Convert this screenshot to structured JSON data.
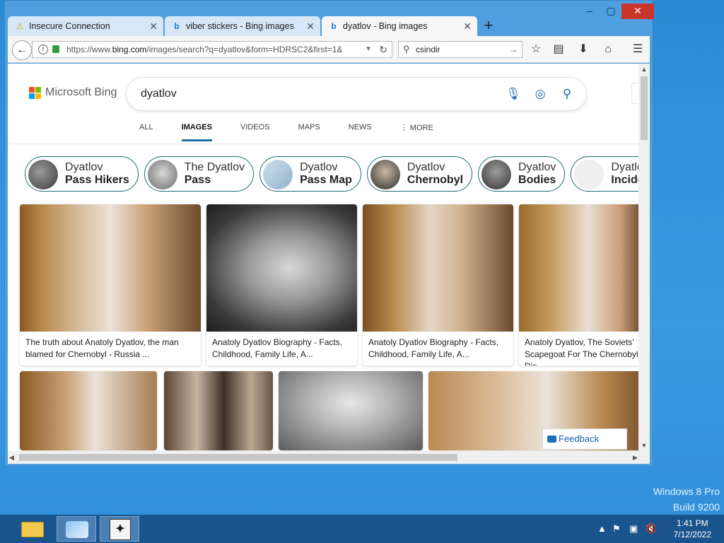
{
  "window": {
    "controls": {
      "minimize": "–",
      "maximize": "▢",
      "close": "✕"
    },
    "tabs": [
      {
        "label": "Insecure Connection",
        "icon": "warning-icon",
        "active": false
      },
      {
        "label": "viber stickers - Bing images",
        "icon": "bing-icon",
        "active": false
      },
      {
        "label": "dyatlov - Bing images",
        "icon": "bing-icon",
        "active": true
      }
    ],
    "new_tab": "+",
    "url": {
      "prefix": "https://www.",
      "host": "bing.com",
      "path": "/images/search?q=dyatlov&form=HDRSC2&first=1&"
    },
    "search_value": "csindir"
  },
  "bing": {
    "logo_text": "Microsoft Bing",
    "query": "dyatlov",
    "scopes": [
      "ALL",
      "IMAGES",
      "VIDEOS",
      "MAPS",
      "NEWS",
      "⋮ MORE"
    ],
    "active_scope": "IMAGES",
    "chips": [
      {
        "l1": "Dyatlov",
        "l2": "Pass Hikers"
      },
      {
        "l1": "The Dyatlov",
        "l2": "Pass"
      },
      {
        "l1": "Dyatlov",
        "l2": "Pass Map"
      },
      {
        "l1": "Dyatlov",
        "l2": "Chernobyl"
      },
      {
        "l1": "Dyatlov",
        "l2": "Bodies"
      },
      {
        "l1": "Dyatlov",
        "l2": "Incident"
      }
    ],
    "results_row1": [
      {
        "caption": "The truth about Anatoly Dyatlov, the man blamed for Chernobyl - Russia ..."
      },
      {
        "caption": "Anatoly Dyatlov Biography - Facts, Childhood, Family Life, A..."
      },
      {
        "caption": "Anatoly Dyatlov Biography - Facts, Childhood, Family Life, A..."
      },
      {
        "caption": "Anatoly Dyatlov, The Soviets' Scapegoat For The Chernobyl Dis..."
      }
    ],
    "feedback": "Feedback"
  },
  "desktop": {
    "os_line1": "Windows 8 Pro",
    "os_line2": "Build 9200"
  },
  "taskbar": {
    "time": "1:41 PM",
    "date": "7/12/2022"
  },
  "colors": {
    "accent": "#1f6fa5",
    "chip_border": "#1b6d73",
    "taskbar": "#19558c",
    "desktop": "#2a8ad4"
  }
}
